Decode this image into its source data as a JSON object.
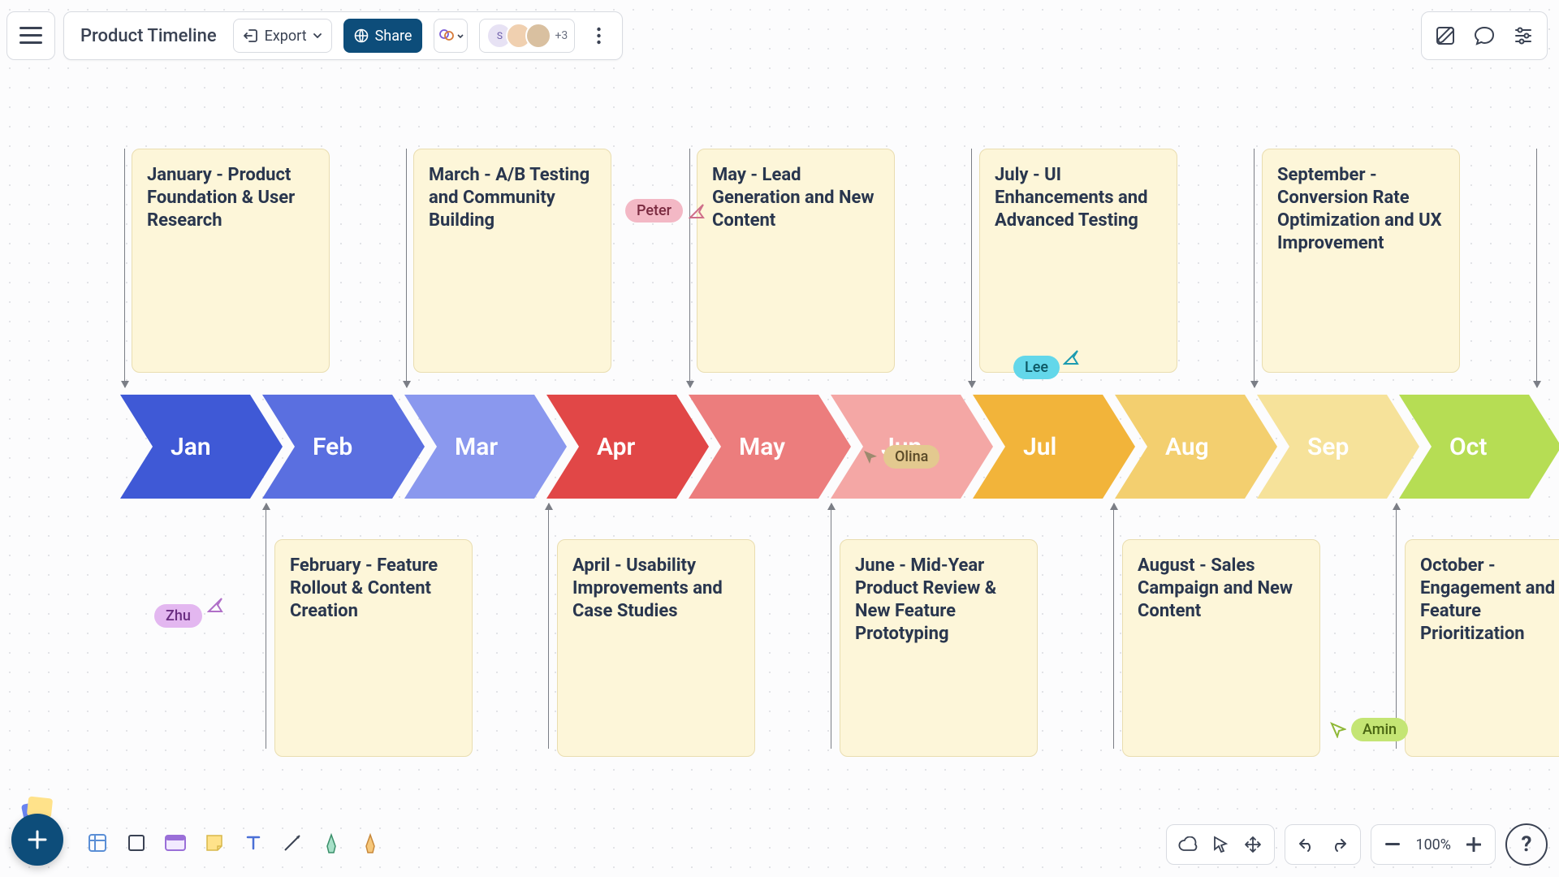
{
  "header": {
    "title": "Product Timeline",
    "export_label": "Export",
    "share_label": "Share",
    "avatar_overflow": "+3"
  },
  "zoom": {
    "level": "100%"
  },
  "timeline": {
    "months": [
      {
        "abbr": "Jan",
        "color": "#3f59d6"
      },
      {
        "abbr": "Feb",
        "color": "#5a6fe0"
      },
      {
        "abbr": "Mar",
        "color": "#8a98ee"
      },
      {
        "abbr": "Apr",
        "color": "#e14747"
      },
      {
        "abbr": "May",
        "color": "#ec7d7d"
      },
      {
        "abbr": "Jun",
        "color": "#f4a7a5"
      },
      {
        "abbr": "Jul",
        "color": "#f2b43a"
      },
      {
        "abbr": "Aug",
        "color": "#f3cf6f"
      },
      {
        "abbr": "Sep",
        "color": "#f6e29a"
      },
      {
        "abbr": "Oct",
        "color": "#b6dd54"
      }
    ],
    "notes_top": [
      {
        "text": "January - Product Foundation & User Research"
      },
      {
        "text": "March - A/B Testing and Community Building"
      },
      {
        "text": "May - Lead Generation and New Content"
      },
      {
        "text": "July - UI Enhancements and Advanced Testing"
      },
      {
        "text": "September - Conversion Rate Optimization and UX Improvement"
      }
    ],
    "notes_bottom": [
      {
        "text": "February - Feature Rollout & Content Creation"
      },
      {
        "text": "April - Usability Improvements and Case Studies"
      },
      {
        "text": "June - Mid-Year Product Review & New Feature Prototyping"
      },
      {
        "text": "August - Sales Campaign and New Content"
      },
      {
        "text": "October - Engagement and Feature Prioritization"
      }
    ]
  },
  "cursors": {
    "peter": "Peter",
    "olina": "Olina",
    "lee": "Lee",
    "zhu": "Zhu",
    "amin": "Amin"
  },
  "icons": {
    "export": "export-icon",
    "share": "globe-icon",
    "copilot": "ai-copilot-icon",
    "edit": "edit-icon",
    "comment": "comment-icon",
    "settings": "sliders-icon",
    "cloud": "cloud-icon",
    "pointer": "pointer-icon",
    "move": "move-icon",
    "undo": "undo-icon",
    "redo": "redo-icon",
    "minus": "zoom-out-icon",
    "plus": "zoom-in-icon",
    "table": "table-icon",
    "rect": "rectangle-icon",
    "card": "card-icon",
    "sticky": "sticky-note-icon",
    "text": "text-icon",
    "line": "line-icon",
    "pen1": "pen-icon",
    "pen2": "highlighter-icon"
  }
}
